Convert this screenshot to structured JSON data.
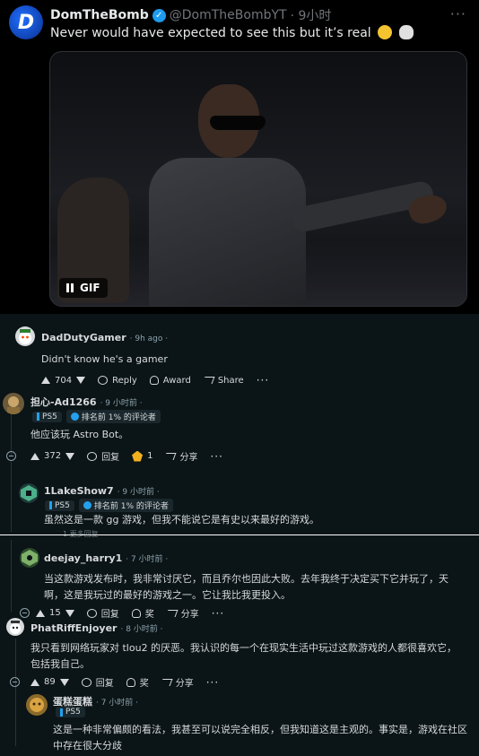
{
  "tweet": {
    "author_name": "DomTheBomb",
    "verified_mark": "✓",
    "handle": "@DomTheBombYT",
    "time": "· 9小时",
    "text": "Never would have expected to see this but it’s real",
    "emojis": [
      "loudly-crying-face",
      "skull"
    ],
    "avatar_letter": "D",
    "media_badge": "GIF",
    "more_icon": "more-dots-icon",
    "brand_color": "#1d9bf0"
  },
  "comments": [
    {
      "user": "DadDutyGamer",
      "time": "· 9h ago ·",
      "body": "Didn't know he's a gamer",
      "upvotes": "704",
      "reply_label": "Reply",
      "award_label": "Award",
      "share_label": "Share"
    },
    {
      "user": "担心-Ad1266",
      "time": "· 9 小时前 ·",
      "flair_platform": "PS5",
      "flair_rank": "排名前 1% 的评论者",
      "body": "他应该玩 Astro Bot。",
      "upvotes": "372",
      "reply_label": "回复",
      "gold_count": "1",
      "share_label": "分享"
    },
    {
      "user": "1LakeShow7",
      "time": "· 9 小时前 ·",
      "flair_platform": "PS5",
      "flair_rank": "排名前 1% 的评论者",
      "body": "虽然这是一款 gg 游戏，但我不能说它是有史以来最好的游戏。",
      "more_replies": "1 更多回复"
    },
    {
      "user": "deejay_harry1",
      "time": "· 7 小时前 ·",
      "body": "当这款游戏发布时，我非常讨厌它，而且乔尔也因此大败。去年我终于决定买下它并玩了，天啊，这是我玩过的最好的游戏之一。它让我比我更投入。",
      "upvotes": "15",
      "reply_label": "回复",
      "award_label": "奖",
      "share_label": "分享"
    },
    {
      "user": "PhatRiffEnjoyer",
      "time": "· 8 小时前 ·",
      "body": "我只看到网络玩家对 tlou2 的厌恶。我认识的每一个在现实生活中玩过这款游戏的人都很喜欢它，包括我自己。",
      "upvotes": "89",
      "reply_label": "回复",
      "award_label": "奖",
      "share_label": "分享"
    },
    {
      "user": "蛋糕蛋糕",
      "time": "· 7 小时前 ·",
      "flair_platform": "PS5",
      "body": "这是一种非常偏颇的看法，我甚至可以说完全相反，但我知道这是主观的。事实是，游戏在社区中存在很大分歧"
    }
  ],
  "colors": {
    "reddit_bg": "#0b1416",
    "rank_blue": "#24a0ed",
    "gold": "#f2b01e"
  }
}
